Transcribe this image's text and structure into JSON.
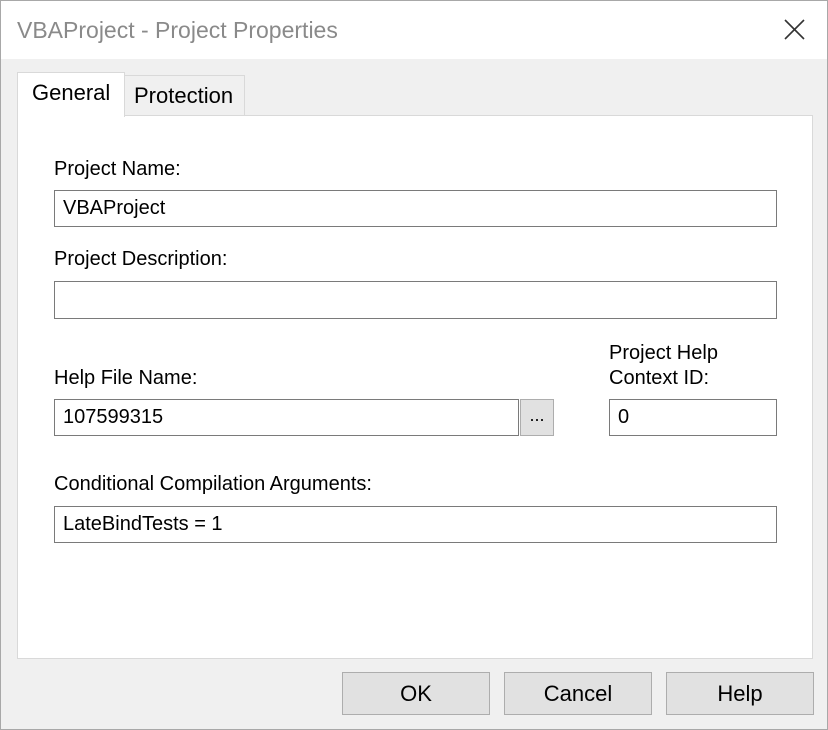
{
  "window": {
    "title": "VBAProject - Project Properties"
  },
  "tabs": [
    {
      "label": "General",
      "selected": true
    },
    {
      "label": "Protection",
      "selected": false
    }
  ],
  "general": {
    "project_name_label": "Project Name:",
    "project_name_value": "VBAProject",
    "project_description_label": "Project Description:",
    "project_description_value": "",
    "help_file_label": "Help File Name:",
    "help_file_value": "107599315",
    "browse_label": "...",
    "help_context_label_line1": "Project Help",
    "help_context_label_line2": "Context ID:",
    "help_context_value": "0",
    "conditional_args_label": "Conditional Compilation Arguments:",
    "conditional_args_value": "LateBindTests = 1"
  },
  "footer": {
    "ok_label": "OK",
    "cancel_label": "Cancel",
    "help_label": "Help"
  },
  "icons": {
    "close": "close-icon"
  },
  "colors": {
    "title_text": "#8a8a8a",
    "window_bg": "#f0f0f0",
    "panel_bg": "#ffffff",
    "button_bg": "#e1e1e1",
    "field_border": "#7a7a7a"
  }
}
